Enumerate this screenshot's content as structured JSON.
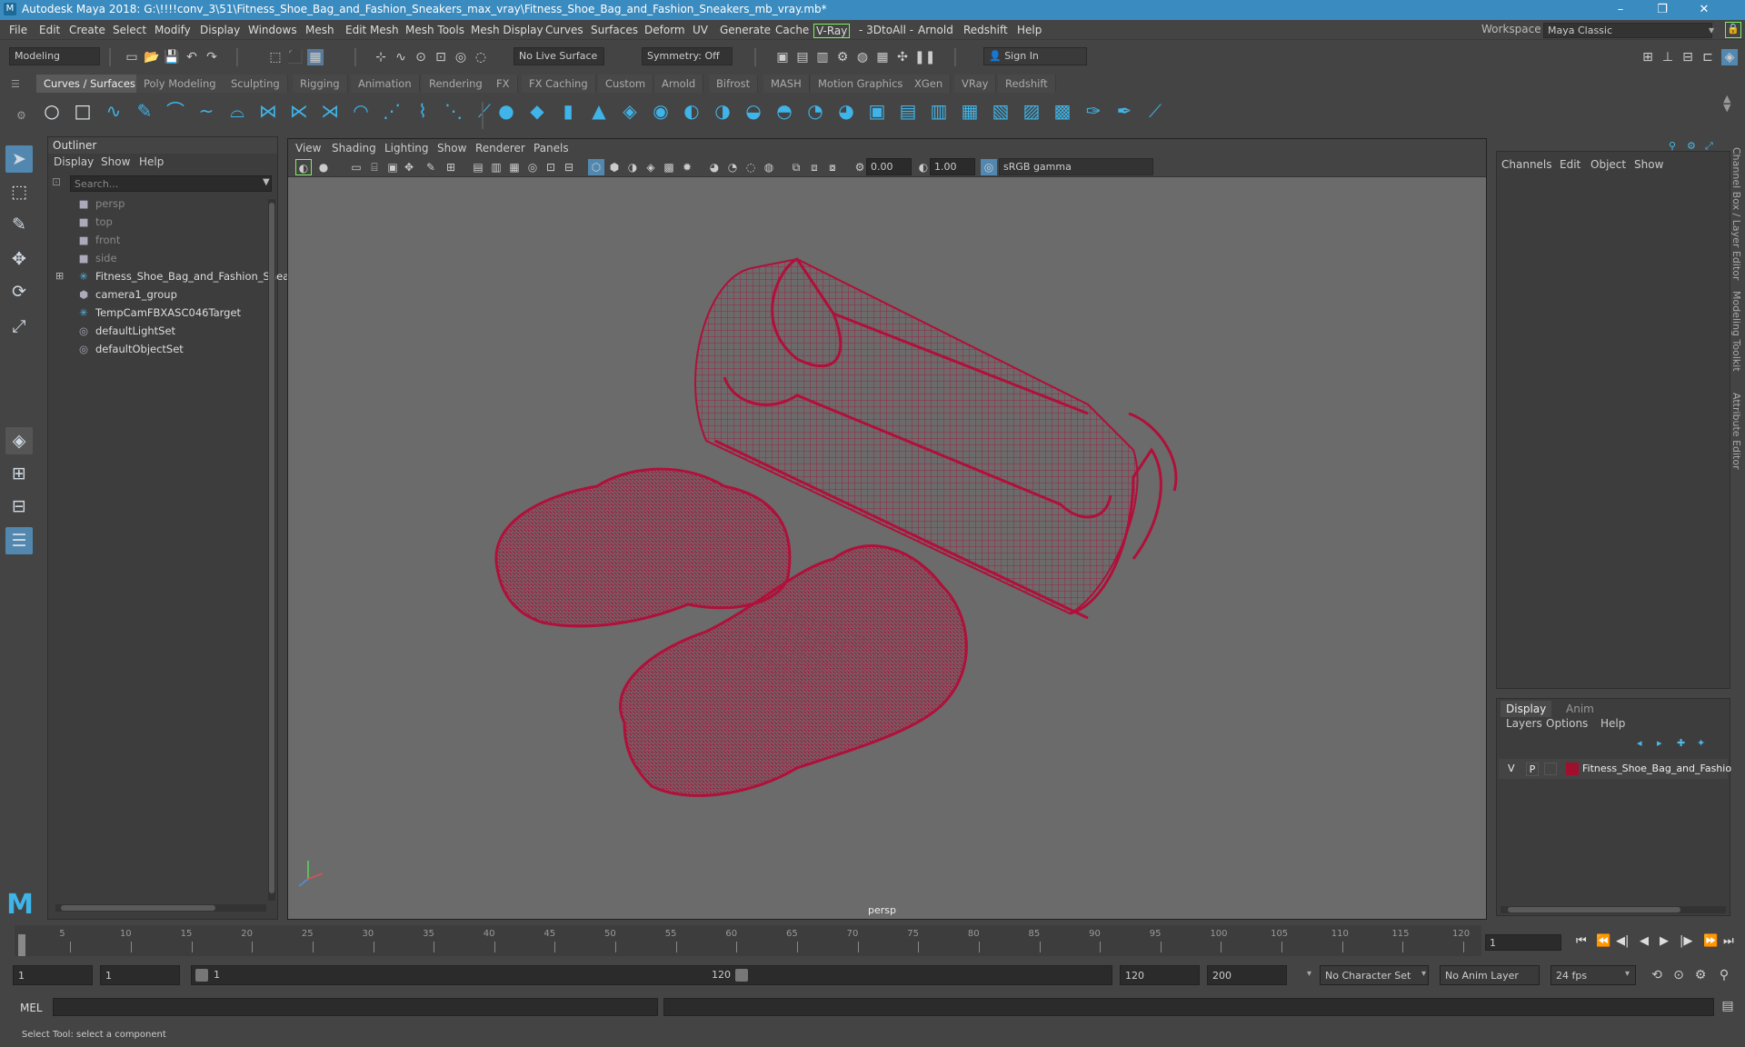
{
  "window": {
    "title": "Autodesk Maya 2018: G:\\!!!!conv_3\\51\\Fitness_Shoe_Bag_and_Fashion_Sneakers_max_vray\\Fitness_Shoe_Bag_and_Fashion_Sneakers_mb_vray.mb*",
    "minimize": "–",
    "maximize": "❐",
    "close": "✕"
  },
  "menubar": {
    "items": [
      "File",
      "Edit",
      "Create",
      "Select",
      "Modify",
      "Display",
      "Windows",
      "Mesh",
      "Edit Mesh",
      "Mesh Tools",
      "Mesh Display",
      "Curves",
      "Surfaces",
      "Deform",
      "UV",
      "Generate",
      "Cache",
      "V-Ray",
      "- 3DtoAll -",
      "Arnold",
      "Redshift",
      "Help"
    ],
    "workspace_label": "Workspace :",
    "workspace_value": "Maya Classic"
  },
  "statusline": {
    "mode": "Modeling",
    "live_surface": "No Live Surface",
    "symmetry": "Symmetry: Off",
    "sign_in": "Sign In"
  },
  "shelf": {
    "tabs": [
      "Curves / Surfaces",
      "Poly Modeling",
      "Sculpting",
      "Rigging",
      "Animation",
      "Rendering",
      "FX",
      "FX Caching",
      "Custom",
      "Arnold",
      "Bifrost",
      "MASH",
      "Motion Graphics",
      "XGen",
      "VRay",
      "Redshift"
    ],
    "active_tab": "Curves / Surfaces"
  },
  "outliner": {
    "title": "Outliner",
    "menu": [
      "Display",
      "Show",
      "Help"
    ],
    "search_placeholder": "Search...",
    "items": [
      {
        "label": "persp",
        "icon": "camera-icon",
        "kind": "cam"
      },
      {
        "label": "top",
        "icon": "camera-icon",
        "kind": "cam"
      },
      {
        "label": "front",
        "icon": "camera-icon",
        "kind": "cam"
      },
      {
        "label": "side",
        "icon": "camera-icon",
        "kind": "cam"
      },
      {
        "label": "Fitness_Shoe_Bag_and_Fashion_Snea",
        "icon": "transform-icon",
        "kind": "obj"
      },
      {
        "label": "camera1_group",
        "icon": "group-icon",
        "kind": "obj"
      },
      {
        "label": "TempCamFBXASC046Target",
        "icon": "transform-icon",
        "kind": "obj"
      },
      {
        "label": "defaultLightSet",
        "icon": "set-icon",
        "kind": "obj"
      },
      {
        "label": "defaultObjectSet",
        "icon": "set-icon",
        "kind": "obj"
      }
    ]
  },
  "viewport": {
    "menu": [
      "View",
      "Shading",
      "Lighting",
      "Show",
      "Renderer",
      "Panels"
    ],
    "exposure": "0.00",
    "gamma": "1.00",
    "colorspace": "sRGB gamma",
    "camera": "persp",
    "wire_color": "#b0103a"
  },
  "channelbox": {
    "menu": [
      "Channels",
      "Edit",
      "Object",
      "Show"
    ],
    "side_tabs": [
      "Channel Box / Layer Editor",
      "Modeling Toolkit",
      "Attribute Editor"
    ]
  },
  "layers": {
    "tabs": [
      "Display",
      "Anim"
    ],
    "menu": [
      "Layers",
      "Options",
      "Help"
    ],
    "layer_v": "V",
    "layer_p": "P",
    "layer_name": "Fitness_Shoe_Bag_and_Fashio",
    "layer_color": "#a0102e"
  },
  "timeline": {
    "ticks": [
      "1",
      "5",
      "10",
      "15",
      "20",
      "25",
      "30",
      "35",
      "40",
      "45",
      "50",
      "55",
      "60",
      "65",
      "70",
      "75",
      "80",
      "85",
      "90",
      "95",
      "100",
      "105",
      "110",
      "115",
      "120"
    ],
    "current_frame": "1"
  },
  "range": {
    "start": "1",
    "playback_start": "1",
    "range_start": "1",
    "range_end": "120",
    "playback_end": "120",
    "end": "200",
    "character_set": "No Character Set",
    "anim_layer": "No Anim Layer",
    "fps": "24 fps"
  },
  "mel": {
    "label": "MEL"
  },
  "helpline": {
    "text": "Select Tool: select a component"
  }
}
